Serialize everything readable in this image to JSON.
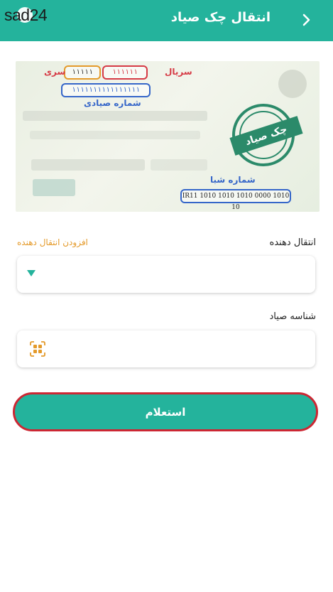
{
  "watermark": "sad24",
  "header": {
    "title": "انتقال چک صیاد"
  },
  "cheque": {
    "serial_label": "سریال",
    "serial_value": "۱۱۱۱۱۱",
    "series_label": "سری",
    "series_value": "۱۱۱۱۱",
    "sayad_number_value": "۱۱۱۱۱۱۱۱۱۱۱۱۱۱۱۱",
    "sayad_number_label": "شماره صیادی",
    "stamp_text": "چک صیاد",
    "sheba_label": "شماره شبا",
    "sheba_value": "IR11 1010 1010 1010 0000 1010 10"
  },
  "form": {
    "transferor_label": "انتقال دهنده",
    "add_transferor_link": "افزودن انتقال دهنده",
    "sayad_id_label": "شناسه صیاد",
    "inquiry_button": "استعلام"
  },
  "colors": {
    "primary": "#24b39c",
    "accent": "#e49a2a",
    "highlight": "#cc2733"
  }
}
